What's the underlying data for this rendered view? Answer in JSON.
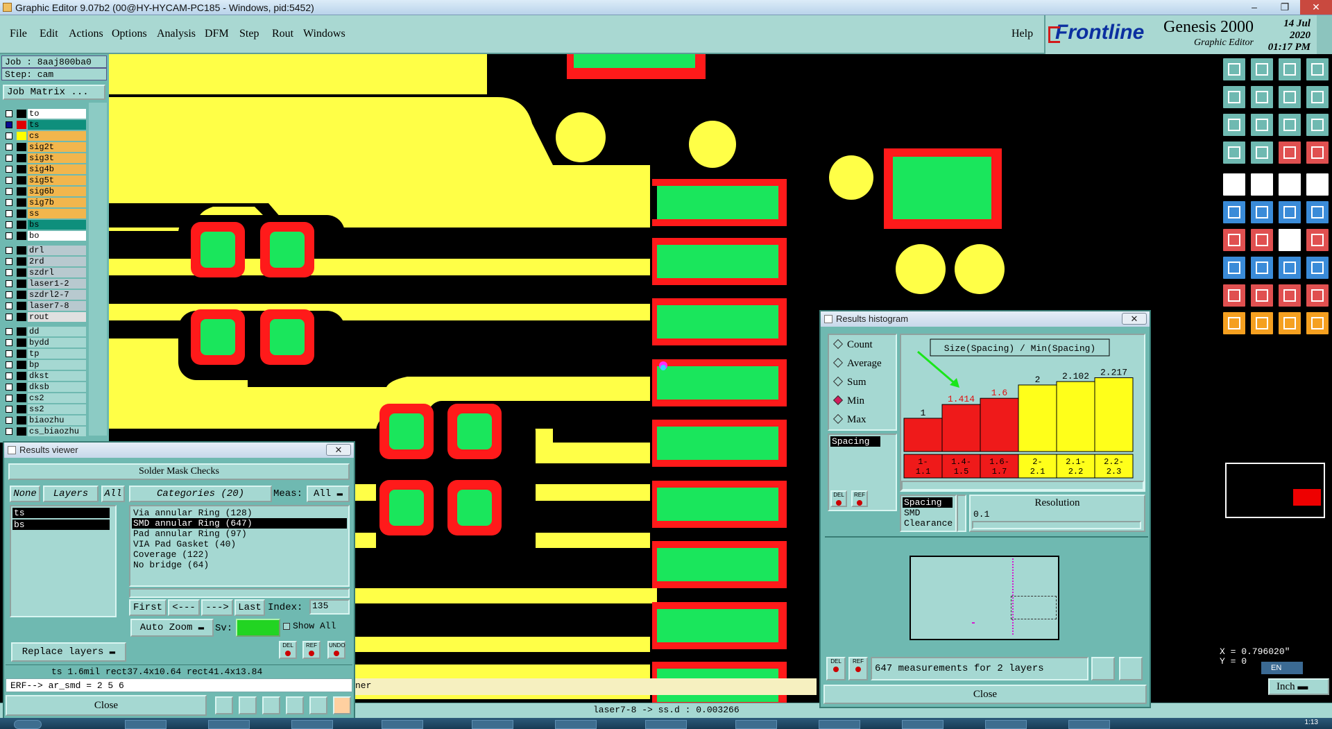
{
  "window": {
    "title": "Graphic Editor 9.07b2 (00@HY-HYCAM-PC185 - Windows, pid:5452)",
    "controls": [
      "–",
      "❐",
      "✕"
    ]
  },
  "menu": {
    "items": [
      "File",
      "Edit",
      "Actions",
      "Options",
      "Analysis",
      "DFM",
      "Step",
      "Rout",
      "Windows"
    ],
    "help": "Help"
  },
  "brand": {
    "logo": "Frontline",
    "product": "Genesis 2000",
    "subtitle": "Graphic Editor",
    "date": "14 Jul 2020",
    "time": "01:17 PM"
  },
  "job": {
    "job_line": "Job : 8aaj800ba0",
    "step_line": "Step: cam",
    "matrix_button": "Job Matrix ..."
  },
  "layers": [
    {
      "name": "to",
      "color": "#ffffff",
      "checked": false,
      "group": 1
    },
    {
      "name": "ts",
      "color": "#0e8f7c",
      "checked": true,
      "group": 1,
      "swatch": "#e00000"
    },
    {
      "name": "cs",
      "color": "#f2b64d",
      "checked": false,
      "group": 1,
      "swatch": "#ffff00"
    },
    {
      "name": "sig2t",
      "color": "#f2b64d",
      "checked": false,
      "group": 1
    },
    {
      "name": "sig3t",
      "color": "#f2b64d",
      "checked": false,
      "group": 1
    },
    {
      "name": "sig4b",
      "color": "#f2b64d",
      "checked": false,
      "group": 1
    },
    {
      "name": "sig5t",
      "color": "#f2b64d",
      "checked": false,
      "group": 1
    },
    {
      "name": "sig6b",
      "color": "#f2b64d",
      "checked": false,
      "group": 1
    },
    {
      "name": "sig7b",
      "color": "#f2b64d",
      "checked": false,
      "group": 1
    },
    {
      "name": "ss",
      "color": "#f2b64d",
      "checked": false,
      "group": 1
    },
    {
      "name": "bs",
      "color": "#0e8f7c",
      "checked": false,
      "group": 1
    },
    {
      "name": "bo",
      "color": "#ffffff",
      "checked": false,
      "group": 1
    },
    {
      "name": "drl",
      "color": "#b8c9cf",
      "checked": false,
      "group": 2
    },
    {
      "name": "2rd",
      "color": "#b8c9cf",
      "checked": false,
      "group": 2
    },
    {
      "name": "szdrl",
      "color": "#b8c9cf",
      "checked": false,
      "group": 2
    },
    {
      "name": "laser1-2",
      "color": "#b8c9cf",
      "checked": false,
      "group": 2
    },
    {
      "name": "szdrl2-7",
      "color": "#b8c9cf",
      "checked": false,
      "group": 2
    },
    {
      "name": "laser7-8",
      "color": "#b8c9cf",
      "checked": false,
      "group": 2
    },
    {
      "name": "rout",
      "color": "#e0e0e0",
      "checked": false,
      "group": 2
    },
    {
      "name": "dd",
      "color": "#a5d8d2",
      "checked": false,
      "group": 3
    },
    {
      "name": "bydd",
      "color": "#a5d8d2",
      "checked": false,
      "group": 3
    },
    {
      "name": "tp",
      "color": "#a5d8d2",
      "checked": false,
      "group": 3
    },
    {
      "name": "bp",
      "color": "#a5d8d2",
      "checked": false,
      "group": 3
    },
    {
      "name": "dkst",
      "color": "#a5d8d2",
      "checked": false,
      "group": 3
    },
    {
      "name": "dksb",
      "color": "#a5d8d2",
      "checked": false,
      "group": 3
    },
    {
      "name": "cs2",
      "color": "#a5d8d2",
      "checked": false,
      "group": 3
    },
    {
      "name": "ss2",
      "color": "#a5d8d2",
      "checked": false,
      "group": 3
    },
    {
      "name": "biaozhu",
      "color": "#a5d8d2",
      "checked": false,
      "group": 3
    },
    {
      "name": "cs_biaozhu",
      "color": "#a5d8d2",
      "checked": false,
      "group": 3
    }
  ],
  "results_viewer": {
    "title": "Results viewer",
    "header": "Solder Mask Checks",
    "none_button": "None",
    "layers_label": "Layers",
    "all_button": "All",
    "categories_label": "Categories (20)",
    "meas_label": "Meas:",
    "meas_value": "All",
    "layer_items": [
      "ts",
      "bs"
    ],
    "categories": [
      "Via annular Ring (128)",
      "SMD annular Ring (647)",
      "Pad annular Ring (97)",
      "VIA Pad Gasket (40)",
      "Coverage (122)",
      "No bridge (64)"
    ],
    "selected_category": 1,
    "first_button": "First",
    "prev_button": "<---",
    "next_button": "--->",
    "last_button": "Last",
    "index_label": "Index:",
    "index_value": "135",
    "zoom_option": "Auto Zoom",
    "sv_label": "Sv:",
    "show_all": "Show All",
    "replace_layers": "Replace layers",
    "info_line": "ts 1.6mil  rect37.4x10.64  rect41.4x13.84",
    "erf_line": "ERF--> ar_smd = 2 5 6",
    "close": "Close",
    "small_buttons": [
      "DEL",
      "REF",
      "UNDO"
    ]
  },
  "histogram": {
    "title": "Results histogram",
    "modes": [
      "Count",
      "Average",
      "Sum",
      "Min",
      "Max"
    ],
    "selected_mode": "Min",
    "list_item": "Spacing",
    "chart_title": "Size(Spacing) / Min(Spacing)",
    "resolution_label": "Resolution",
    "resolution_value": "0.1",
    "categories_list": [
      "Spacing",
      "SMD",
      "Clearance"
    ],
    "footer_text": "647 measurements for 2 layers",
    "close": "Close",
    "del": "DEL",
    "ref": "REF"
  },
  "chart_data": {
    "type": "bar",
    "title": "Size(Spacing) / Min(Spacing)",
    "categories": [
      "1-\n1.1",
      "1.4-\n1.5",
      "1.6-\n1.7",
      "2-\n2.1",
      "2.1-\n2.2",
      "2.2-\n2.3"
    ],
    "values": [
      1,
      1.414,
      1.6,
      2,
      2.102,
      2.217
    ],
    "value_labels": [
      "1",
      "1.414",
      "1.6",
      "2",
      "2.102",
      "2.217"
    ],
    "bar_colors": [
      "#ef1a1a",
      "#ef1a1a",
      "#ef1a1a",
      "#ffff1a",
      "#ffff1a",
      "#ffff1a"
    ],
    "label_colors": [
      "#000000",
      "#e01010",
      "#e01010",
      "#000000",
      "#000000",
      "#000000"
    ],
    "ylim": [
      0,
      2.5
    ]
  },
  "canvas": {
    "message_suffix": "ner"
  },
  "status": {
    "center": "laser7-8 -> ss.d : 0.003266",
    "coord_x": "X = 0.796020\"",
    "coord_y": "Y = 0",
    "units": "Inch",
    "lang": "EN"
  },
  "taskbar": {
    "time": "1:13"
  },
  "colors": {
    "panel": "#6fb9b1",
    "panel_light": "#a5d8d2",
    "copper": "#ffff47",
    "mask_red": "#ff1a1a",
    "pad_green": "#1ae65c"
  }
}
